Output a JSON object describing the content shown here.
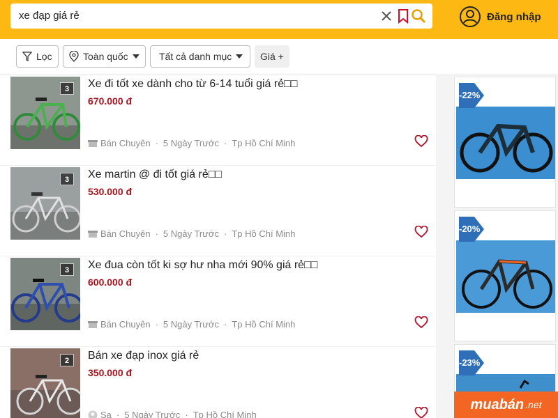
{
  "search": {
    "query": "xe đạp giá rẻ"
  },
  "header": {
    "login_label": "Đăng nhập"
  },
  "filters": {
    "filter_label": "Lọc",
    "location_label": "Toàn quốc",
    "category_label": "Tất cả danh mục",
    "price_label": "Giá +"
  },
  "listings": [
    {
      "title": "Xe đi tốt xe dành cho từ 6-14 tuổi giá rẻ□□",
      "price": "670.000 đ",
      "photos": "3",
      "seller": "Bán Chuyên",
      "time": "5 Ngày Trước",
      "location": "Tp Hồ Chí Minh"
    },
    {
      "title": "Xe martin @ đi tốt giá rẻ□□",
      "price": "530.000 đ",
      "photos": "3",
      "seller": "Bán Chuyên",
      "time": "5 Ngày Trước",
      "location": "Tp Hồ Chí Minh"
    },
    {
      "title": "Xe đua còn tốt ki sợ hư nha mới 90% giá rẻ□□",
      "price": "600.000 đ",
      "photos": "3",
      "seller": "Bán Chuyên",
      "time": "5 Ngày Trước",
      "location": "Tp Hồ Chí Minh"
    },
    {
      "title": "Bán xe đạp inox giá rẻ",
      "price": "350.000 đ",
      "photos": "2",
      "seller": "Sa",
      "time": "5 Ngày Trước",
      "location": "Tp Hồ Chí Minh"
    }
  ],
  "ads": [
    {
      "discount": "-22%"
    },
    {
      "discount": "-20%"
    },
    {
      "discount": "-23%"
    }
  ],
  "brand": {
    "logo_main": "muabán",
    "logo_suffix": ".net"
  },
  "colors": {
    "header_bg": "#fdb813",
    "price": "#a8141e",
    "brand": "#f26522",
    "discount_tag": "#2f6fb7"
  }
}
